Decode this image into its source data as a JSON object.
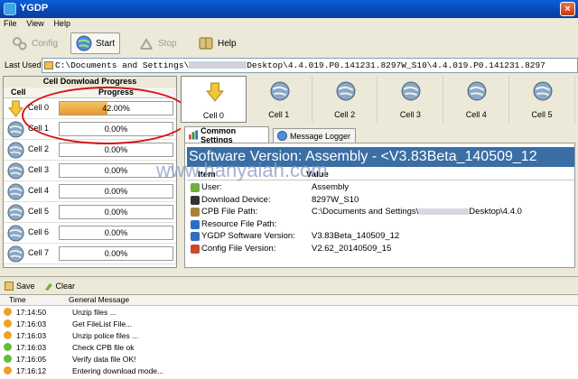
{
  "window": {
    "title": "YGDP",
    "close_glyph": "×"
  },
  "menu": [
    "File",
    "View",
    "Help"
  ],
  "toolbar": {
    "config": "Config",
    "start": "Start",
    "stop": "Stop",
    "help": "Help"
  },
  "last_used": {
    "label": "Last Used:",
    "path": "C:\\Documents and Settings\\",
    "path_rest": "Desktop\\4.4.019.P0.141231.8297W_S10\\4.4.019.P0.141231.8297"
  },
  "left_panel": {
    "title": "Cell Donwload Progress",
    "col_cell": "Cell",
    "col_progress": "Progress",
    "cells": [
      {
        "name": "Cell 0",
        "progress": "42.00%",
        "value": 0.42
      },
      {
        "name": "Cell 1",
        "progress": "0.00%",
        "value": 0
      },
      {
        "name": "Cell 2",
        "progress": "0.00%",
        "value": 0
      },
      {
        "name": "Cell 3",
        "progress": "0.00%",
        "value": 0
      },
      {
        "name": "Cell 4",
        "progress": "0.00%",
        "value": 0
      },
      {
        "name": "Cell 5",
        "progress": "0.00%",
        "value": 0
      },
      {
        "name": "Cell 6",
        "progress": "0.00%",
        "value": 0
      },
      {
        "name": "Cell 7",
        "progress": "0.00%",
        "value": 0
      }
    ]
  },
  "cell_strip": [
    "Cell 0",
    "Cell 1",
    "Cell 2",
    "Cell 3",
    "Cell 4",
    "Cell 5"
  ],
  "tabs": {
    "settings": "Common Settings",
    "logger": "Message Logger"
  },
  "settings": {
    "banner": "Software Version:  Assembly - <V3.83Beta_140509_12",
    "watermark": "www.hanyaiah.com",
    "col_item": "Item",
    "col_value": "Value",
    "rows": [
      {
        "name": "User:",
        "value": "Assembly"
      },
      {
        "name": "Download Device:",
        "value": "8297W_S10"
      },
      {
        "name": "CPB File Path:",
        "value": "C:\\Documents and Settings\\",
        "value_rest": "Desktop\\4.4.0"
      },
      {
        "name": "Resource File Path:",
        "value": ""
      },
      {
        "name": "YGDP Software Version:",
        "value": "V3.83Beta_140509_12"
      },
      {
        "name": "Config File Version:",
        "value": "V2.62_20140509_15"
      }
    ]
  },
  "log_toolbar": {
    "save": "Save",
    "clear": "Clear"
  },
  "log": {
    "col_time": "Time",
    "col_msg": "General Message",
    "rows": [
      {
        "time": "17:14:50",
        "msg": "Unzip files ...",
        "status": "warning"
      },
      {
        "time": "17:16:03",
        "msg": "Get FileList File...",
        "status": "warning"
      },
      {
        "time": "17:16:03",
        "msg": "Unzip police files ...",
        "status": "warning"
      },
      {
        "time": "17:16:03",
        "msg": "Check CPB file ok",
        "status": "ok"
      },
      {
        "time": "17:16:05",
        "msg": "Verify data file OK!",
        "status": "ok"
      },
      {
        "time": "17:16:12",
        "msg": "Entering download mode...",
        "status": "warning"
      }
    ]
  },
  "colors": {
    "accent": "#0a5fd8",
    "progress": "#e99a26",
    "warning": "#f0a02a",
    "ok": "#5fbf3b",
    "annotation": "#d41414"
  }
}
